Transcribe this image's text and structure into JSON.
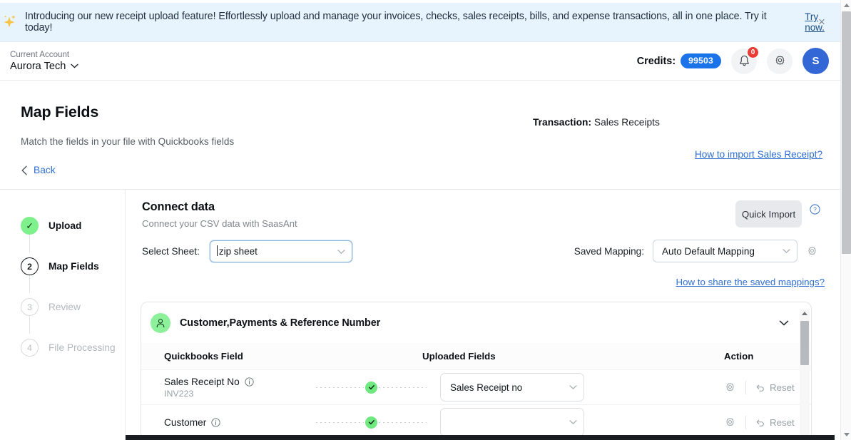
{
  "banner": {
    "icon": "sparkle-icon",
    "message": "Introducing our new receipt upload feature! Effortlessly upload and manage your invoices, checks, sales receipts, bills, and expense transactions, all in one place. Try it today!",
    "link_label": "Try now.",
    "close_label": "×",
    "bg_color": "#e8f4fd"
  },
  "topbar": {
    "account_label": "Current Account",
    "account_name": "Aurora Tech",
    "credits_label": "Credits:",
    "credits_value": "99503",
    "credits_color": "#1a73e8",
    "notification_badge": "0",
    "badge_color": "#ea3b35",
    "avatar_initial": "S",
    "avatar_color": "#3367d6"
  },
  "page": {
    "title": "Map Fields",
    "subtitle": "Match the fields in your file with Quickbooks fields",
    "back_label": "Back",
    "transaction_label": "Transaction:",
    "transaction_value": "Sales Receipts",
    "howto_link": "How to import Sales Receipt?",
    "link_color": "#2f6fd0"
  },
  "stepper": {
    "steps": [
      {
        "number": "✓",
        "label": "Upload",
        "state": "done"
      },
      {
        "number": "2",
        "label": "Map Fields",
        "state": "active"
      },
      {
        "number": "3",
        "label": "Review",
        "state": "pending"
      },
      {
        "number": "4",
        "label": "File Processing",
        "state": "pending"
      }
    ]
  },
  "connect": {
    "title": "Connect data",
    "subtitle": "Connect your CSV data with SaasAnt",
    "select_sheet_label": "Select Sheet:",
    "select_sheet_value": "zip sheet",
    "quick_import_label": "Quick Import",
    "saved_mapping_label": "Saved Mapping:",
    "saved_mapping_value": "Auto Default Mapping",
    "share_link": "How to share the saved mappings?"
  },
  "mapping_card": {
    "group_title": "Customer,Payments & Reference Number",
    "columns": {
      "quickbooks": "Quickbooks Field",
      "uploaded": "Uploaded Fields",
      "action": "Action"
    },
    "rows": [
      {
        "qb_field": "Sales Receipt No",
        "sample": "INV223",
        "uploaded_field": "Sales Receipt no",
        "mapped": true,
        "reset_label": "Reset"
      },
      {
        "qb_field": "Customer",
        "sample": "",
        "uploaded_field": "",
        "mapped": true,
        "reset_label": "Reset"
      }
    ]
  }
}
